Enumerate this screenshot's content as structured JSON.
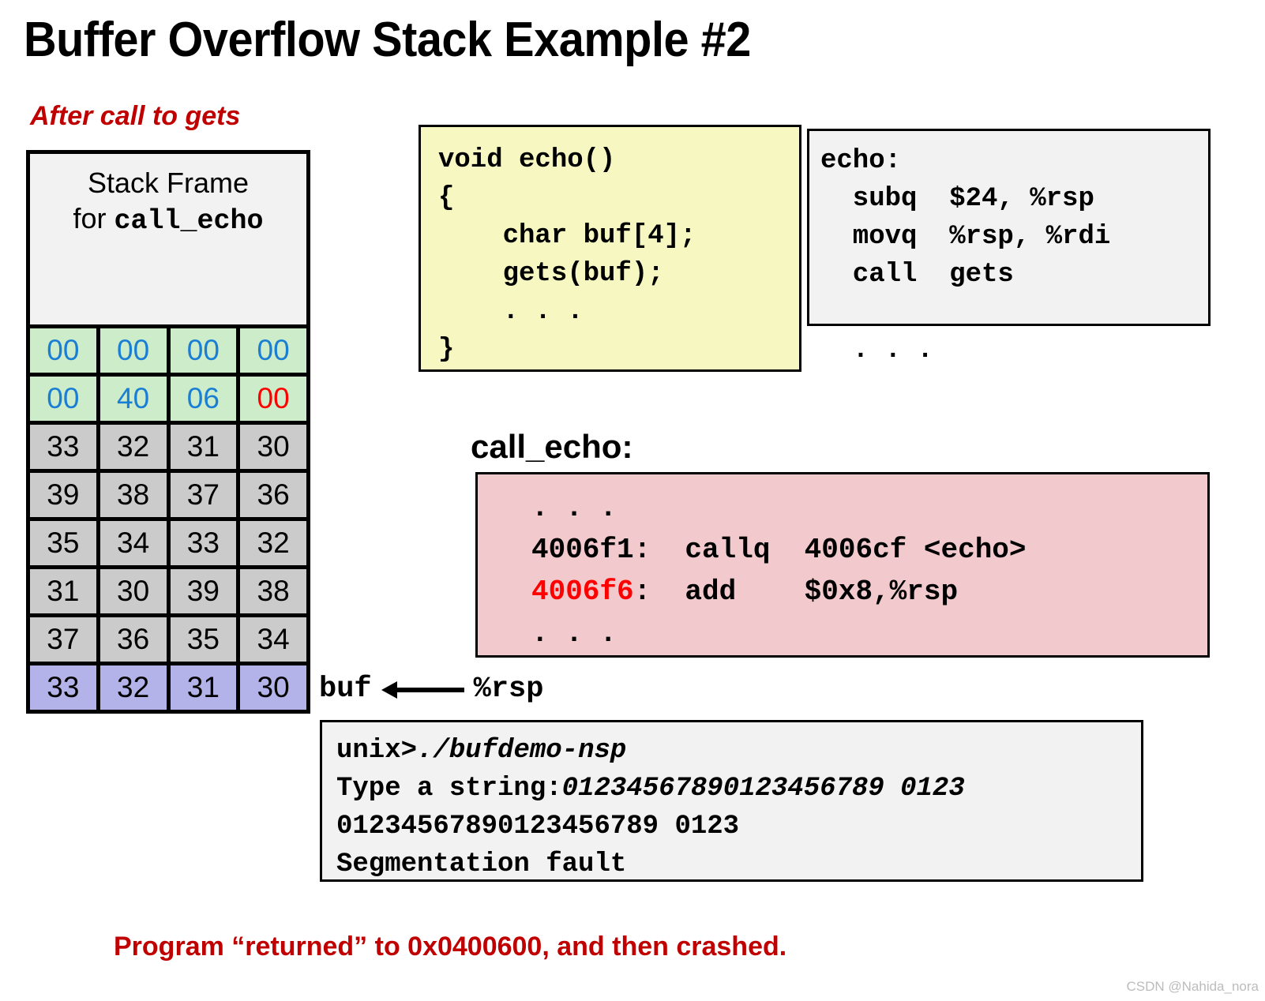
{
  "slide": {
    "title": "Buffer Overflow Stack Example #2",
    "subtitle": "After call to gets",
    "bottom_caption": "Program “returned” to 0x0400600, and then crashed.",
    "watermark": "CSDN @Nahida_nora"
  },
  "stack": {
    "header_line1": "Stack Frame",
    "header_line2_prefix": "for ",
    "header_line2_mono": "call_echo",
    "rows": [
      {
        "style": "green",
        "cells": [
          {
            "text": "00",
            "color": "blue"
          },
          {
            "text": "00",
            "color": "blue"
          },
          {
            "text": "00",
            "color": "blue"
          },
          {
            "text": "00",
            "color": "blue"
          }
        ]
      },
      {
        "style": "green",
        "cells": [
          {
            "text": "00",
            "color": "blue"
          },
          {
            "text": "40",
            "color": "blue"
          },
          {
            "text": "06",
            "color": "blue"
          },
          {
            "text": "00",
            "color": "red"
          }
        ]
      },
      {
        "style": "gray",
        "cells": [
          {
            "text": "33",
            "color": "black"
          },
          {
            "text": "32",
            "color": "black"
          },
          {
            "text": "31",
            "color": "black"
          },
          {
            "text": "30",
            "color": "black"
          }
        ]
      },
      {
        "style": "gray",
        "cells": [
          {
            "text": "39",
            "color": "black"
          },
          {
            "text": "38",
            "color": "black"
          },
          {
            "text": "37",
            "color": "black"
          },
          {
            "text": "36",
            "color": "black"
          }
        ]
      },
      {
        "style": "gray",
        "cells": [
          {
            "text": "35",
            "color": "black"
          },
          {
            "text": "34",
            "color": "black"
          },
          {
            "text": "33",
            "color": "black"
          },
          {
            "text": "32",
            "color": "black"
          }
        ]
      },
      {
        "style": "gray",
        "cells": [
          {
            "text": "31",
            "color": "black"
          },
          {
            "text": "30",
            "color": "black"
          },
          {
            "text": "39",
            "color": "black"
          },
          {
            "text": "38",
            "color": "black"
          }
        ]
      },
      {
        "style": "gray",
        "cells": [
          {
            "text": "37",
            "color": "black"
          },
          {
            "text": "36",
            "color": "black"
          },
          {
            "text": "35",
            "color": "black"
          },
          {
            "text": "34",
            "color": "black"
          }
        ]
      },
      {
        "style": "purple",
        "cells": [
          {
            "text": "33",
            "color": "black"
          },
          {
            "text": "32",
            "color": "black"
          },
          {
            "text": "31",
            "color": "black"
          },
          {
            "text": "30",
            "color": "black"
          }
        ]
      }
    ],
    "buf_label": "buf",
    "rsp_label": "%rsp"
  },
  "c_code": "void echo()\n{\n    char buf[4];\n    gets(buf);\n    . . .\n}",
  "asm_echo": "echo:\n  subq  $24, %rsp\n  movq  %rsp, %rdi\n  call  gets\n\n  . . .",
  "call_echo": {
    "title": "call_echo:",
    "line_dots_top": ". . .",
    "line_callq": "4006f1:  callq  4006cf <echo>",
    "line_add_addr": "4006f6",
    "line_add_rest": ":  add    $0x8,%rsp",
    "line_dots_bottom": ". . ."
  },
  "terminal": {
    "line1_prefix": "unix>",
    "line1_cmd": "./bufdemo-nsp",
    "line2_prefix": "Type a string:",
    "line2_input": "01234567890123456789 0123",
    "line3": "01234567890123456789 0123",
    "line4": "Segmentation fault"
  },
  "colors": {
    "accent_red": "#c00000",
    "hex_blue": "#1a7fd4",
    "hex_red": "#ff0000",
    "green_cell": "#cdecca",
    "gray_cell": "#cbcbcb",
    "purple_cell": "#b3b3ea",
    "yellow_box": "#f7f7c2",
    "pink_box": "#f2c9cc",
    "gray_box": "#f2f2f2"
  }
}
